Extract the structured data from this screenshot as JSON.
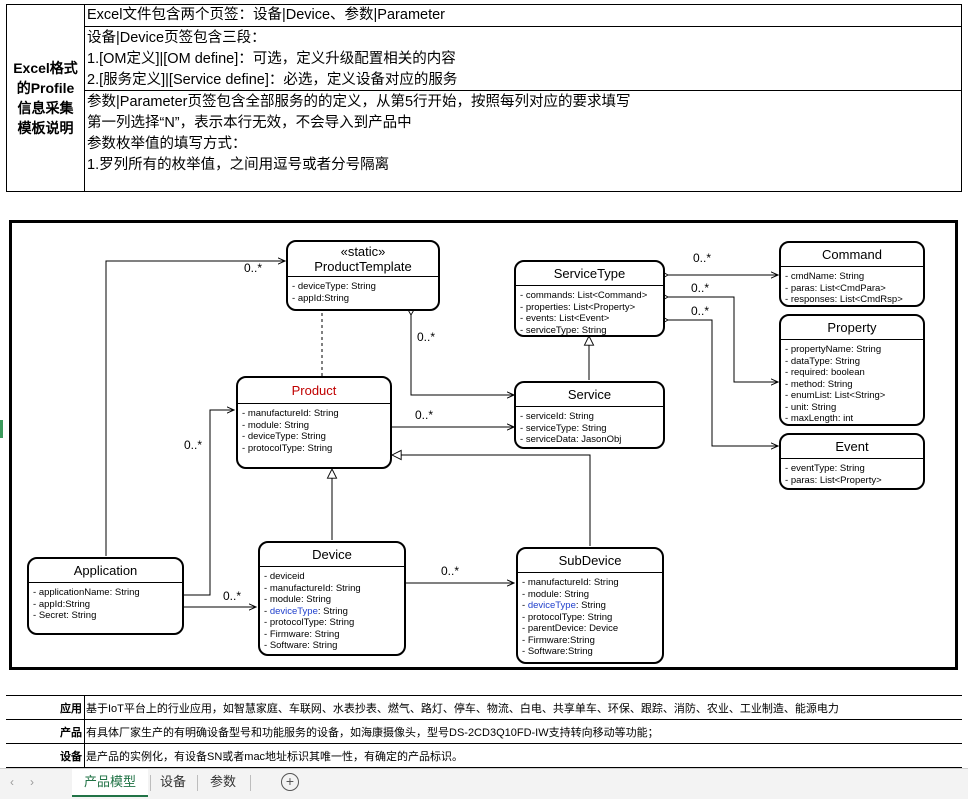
{
  "info": {
    "side_label_lines": [
      "Excel格式",
      "的Profile",
      "信息采集",
      "模板说明"
    ],
    "row1": "Excel文件包含两个页签：设备|Device、参数|Parameter",
    "row2": [
      "设备|Device页签包含三段：",
      "1.[OM定义]|[OM define]：可选，定义升级配置相关的内容",
      "2.[服务定义]|[Service define]：必选，定义设备对应的服务"
    ],
    "row3": [
      "参数|Parameter页签包含全部服务的的定义，从第5行开始，按照每列对应的要求填写",
      "第一列选择“N”，表示本行无效，不会导入到产品中",
      "参数枚举值的填写方式：",
      "1.罗列所有的枚举值，之间用逗号或者分号隔离"
    ]
  },
  "diagram": {
    "product_template": {
      "stereotype": "«static»",
      "name": "ProductTemplate",
      "attrs": [
        "deviceType: String",
        "appId:String"
      ]
    },
    "product": {
      "name": "Product",
      "name_color": "#c00000",
      "attrs": [
        "manufactureId: String",
        "module: String",
        "deviceType: String",
        "protocolType: String"
      ]
    },
    "service_type": {
      "name": "ServiceType",
      "attrs": [
        "commands: List<Command>",
        "properties: List<Property>",
        "events: List<Event>",
        "serviceType: String"
      ]
    },
    "service": {
      "name": "Service",
      "attrs": [
        "serviceId: String",
        "serviceType: String",
        "serviceData: JasonObj"
      ]
    },
    "command": {
      "name": "Command",
      "attrs": [
        "cmdName: String",
        "paras: List<CmdPara>",
        "responses: List<CmdRsp>"
      ]
    },
    "property": {
      "name": "Property",
      "attrs": [
        "propertyName: String",
        "dataType: String",
        "required: boolean",
        "method: String",
        "enumList: List<String>",
        "unit: String",
        "maxLength: int"
      ]
    },
    "event": {
      "name": "Event",
      "attrs": [
        "eventType: String",
        "paras: List<Property>"
      ]
    },
    "application": {
      "name": "Application",
      "attrs": [
        "applicationName: String",
        "appId:String",
        "Secret: String"
      ]
    },
    "device": {
      "name": "Device",
      "attrs": [
        "deviceid",
        "manufactureId: String",
        "module: String",
        "deviceType: String",
        "protocolType: String",
        "Firmware: String",
        "Software: String"
      ],
      "highlight_prefix": "deviceType"
    },
    "subdevice": {
      "name": "SubDevice",
      "attrs": [
        "manufactureId: String",
        "module: String",
        "deviceType: String",
        "protocolType: String",
        "parentDevice: Device",
        "Firmware:String",
        "Software:String"
      ],
      "highlight_prefix": "deviceType"
    },
    "highlight_color": "#1f3fcc",
    "multiplicity": "0..*"
  },
  "definitions": [
    {
      "key": "应用",
      "value": "基于IoT平台上的行业应用，如智慧家庭、车联网、水表抄表、燃气、路灯、停车、物流、白电、共享单车、环保、跟踪、消防、农业、工业制造、能源电力"
    },
    {
      "key": "产品",
      "value": "有具体厂家生产的有明确设备型号和功能服务的设备，如海康摄像头，型号DS-2CD3Q10FD-IW支持转向移动等功能；"
    },
    {
      "key": "设备",
      "value": "是产品的实例化，有设备SN或者mac地址标识其唯一性，有确定的产品标识。"
    }
  ],
  "tabs": {
    "active": "产品模型",
    "others": [
      "设备",
      "参数"
    ],
    "add_symbol": "+",
    "prev": "‹",
    "next": "›",
    "accent": "#217346"
  }
}
